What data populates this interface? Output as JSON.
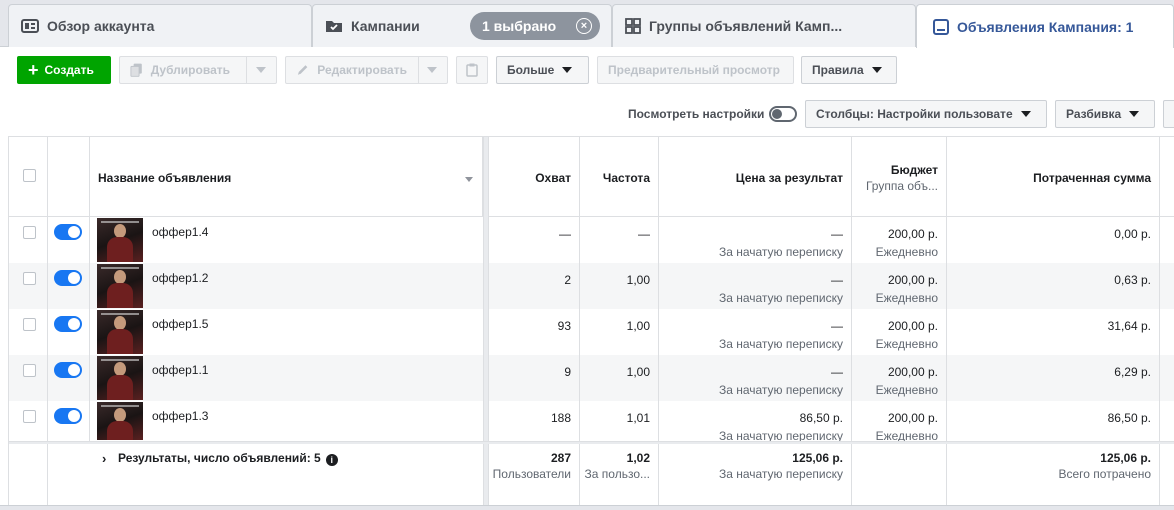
{
  "tabs": {
    "overview": "Обзор аккаунта",
    "campaigns": "Кампании",
    "selected": "1 выбрано",
    "adsets": "Группы объявлений Камп...",
    "ads": "Объявления Кампания: 1"
  },
  "toolbar": {
    "create": "Создать",
    "duplicate": "Дублировать",
    "edit": "Редактировать",
    "more": "Больше",
    "preview": "Предварительный просмотр",
    "rules": "Правила",
    "view_settings": "Посмотреть настройки",
    "columns": "Столбцы: Настройки пользовате",
    "breakdown": "Разбивка"
  },
  "columns": {
    "name": "Название объявления",
    "reach": "Охват",
    "frequency": "Частота",
    "cost": "Цена за результат",
    "budget": "Бюджет",
    "budget_sub": "Группа объ...",
    "spent": "Потраченная сумма"
  },
  "rows": [
    {
      "name": "оффер1.4",
      "reach": "—",
      "frequency": "—",
      "cost": "—",
      "cost_sub": "За начатую переписку",
      "budget": "200,00 р.",
      "budget_sub": "Ежедневно",
      "spent": "0,00 р."
    },
    {
      "name": "оффер1.2",
      "reach": "2",
      "frequency": "1,00",
      "cost": "—",
      "cost_sub": "За начатую переписку",
      "budget": "200,00 р.",
      "budget_sub": "Ежедневно",
      "spent": "0,63 р."
    },
    {
      "name": "оффер1.5",
      "reach": "93",
      "frequency": "1,00",
      "cost": "—",
      "cost_sub": "За начатую переписку",
      "budget": "200,00 р.",
      "budget_sub": "Ежедневно",
      "spent": "31,64 р."
    },
    {
      "name": "оффер1.1",
      "reach": "9",
      "frequency": "1,00",
      "cost": "—",
      "cost_sub": "За начатую переписку",
      "budget": "200,00 р.",
      "budget_sub": "Ежедневно",
      "spent": "6,29 р."
    },
    {
      "name": "оффер1.3",
      "reach": "188",
      "frequency": "1,01",
      "cost": "86,50 р.",
      "cost_sub": "За начатую переписку",
      "budget": "200,00 р.",
      "budget_sub": "Ежедневно",
      "spent": "86,50 р."
    }
  ],
  "totals": {
    "label": "Результаты, число объявлений: 5",
    "reach": "287",
    "reach_sub": "Пользователи",
    "frequency": "1,02",
    "frequency_sub": "За пользо...",
    "cost": "125,06 р.",
    "cost_sub": "За начатую переписку",
    "spent": "125,06 р.",
    "spent_sub": "Всего потрачено"
  },
  "colors": {
    "accent": "#1877f2",
    "create_button": "#00a400",
    "active_tab_text": "#365899"
  },
  "icons": {
    "overview": "account-overview-icon",
    "campaigns": "folder-check-icon",
    "adsets": "grid-icon",
    "ads": "ad-square-icon"
  }
}
